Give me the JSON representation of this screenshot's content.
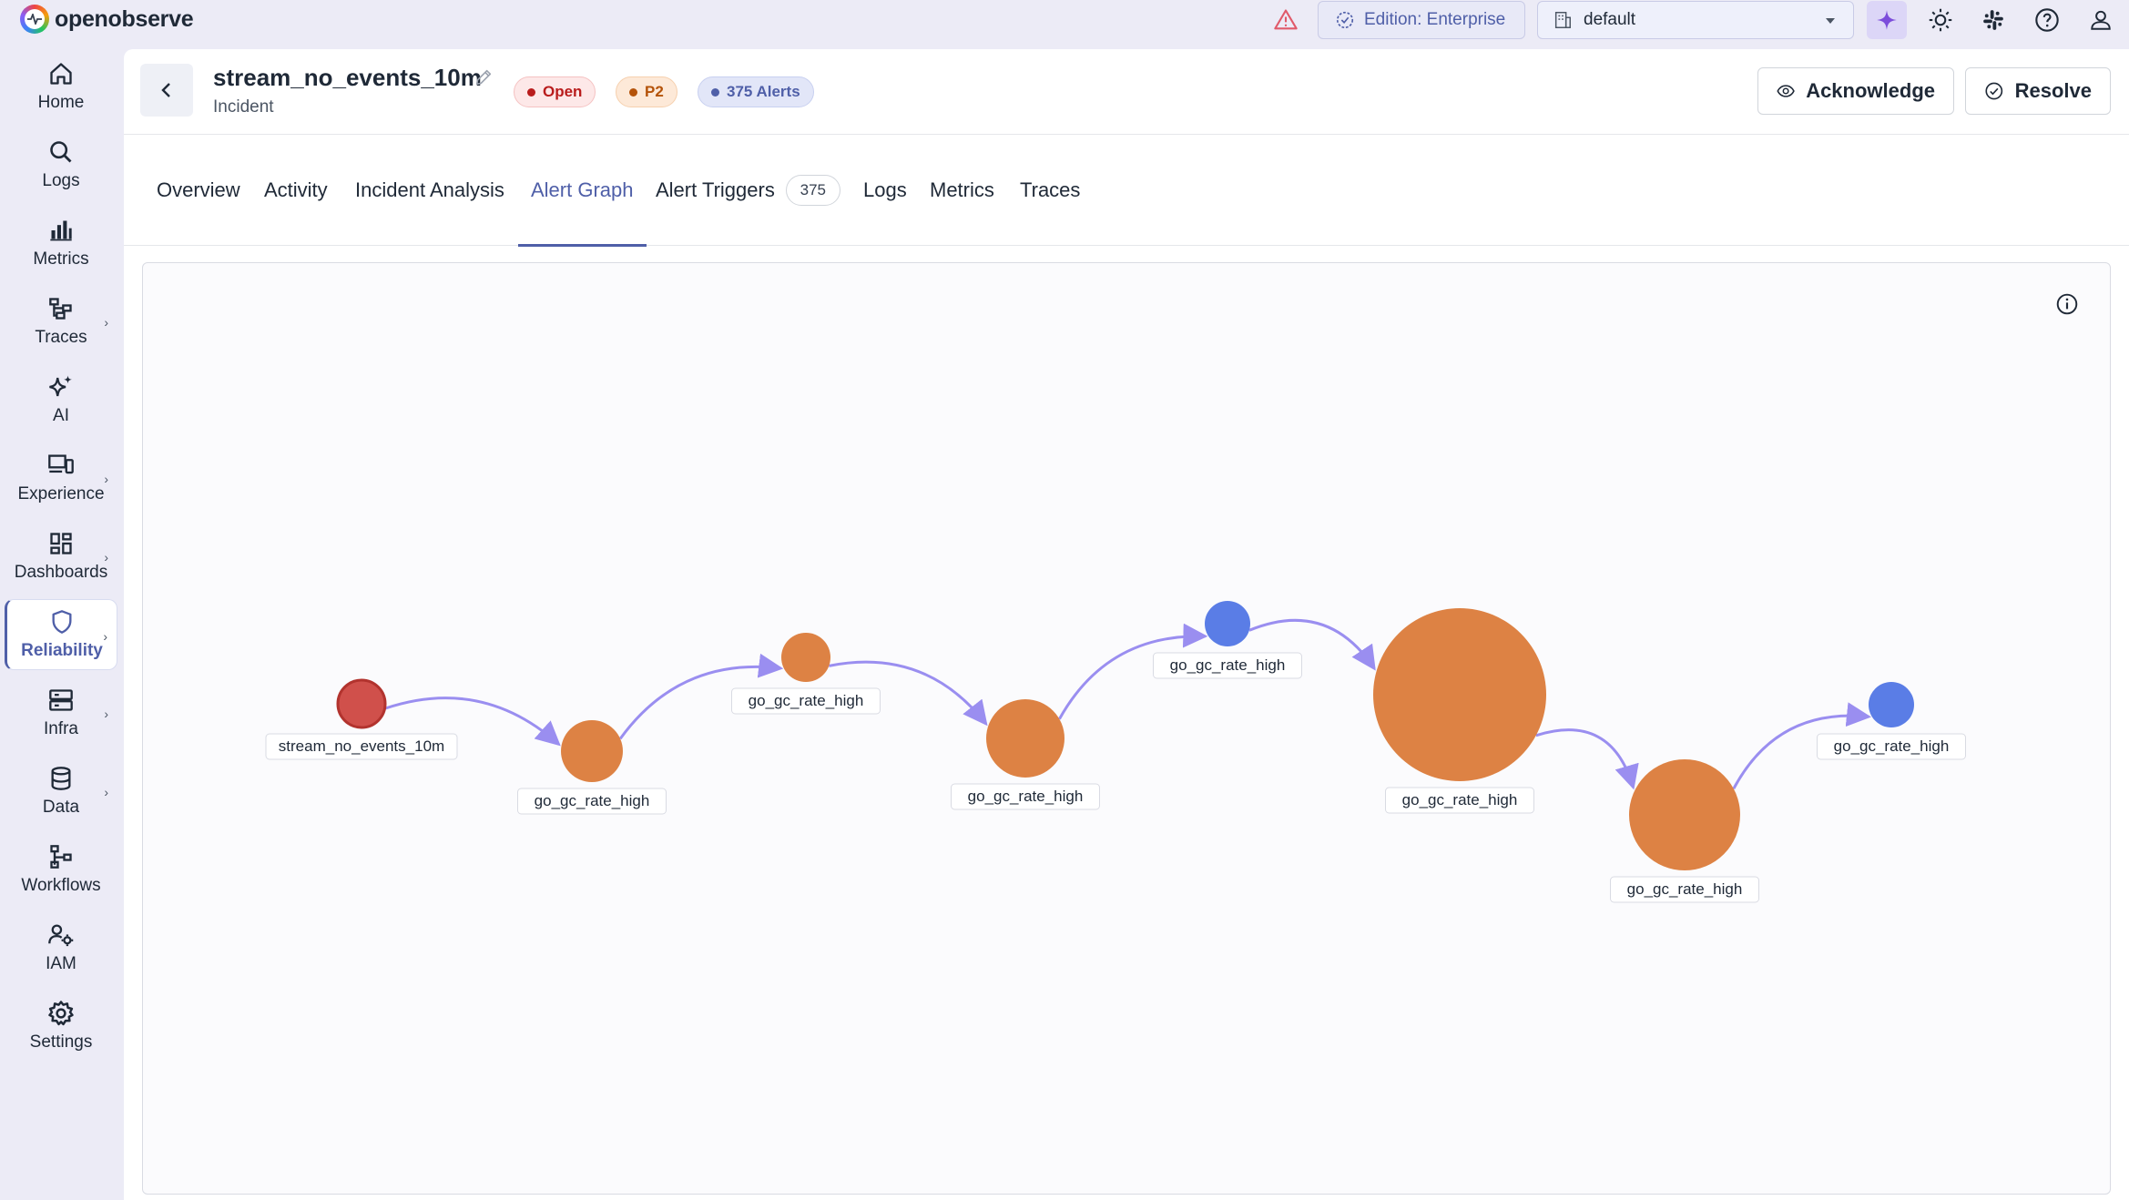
{
  "app": {
    "logo_text": "openobserve"
  },
  "topbar": {
    "edition_label": "Edition: Enterprise",
    "org_select_value": "default",
    "icons": [
      "warning-icon",
      "edition-icon",
      "building-icon",
      "ai-sparkle-icon",
      "sun-icon",
      "slack-icon",
      "help-icon",
      "user-icon"
    ]
  },
  "sidebar": {
    "items": [
      {
        "label": "Home",
        "icon": "home-icon",
        "has_submenu": false
      },
      {
        "label": "Logs",
        "icon": "search-icon",
        "has_submenu": false
      },
      {
        "label": "Metrics",
        "icon": "bar-chart-icon",
        "has_submenu": false
      },
      {
        "label": "Traces",
        "icon": "traces-icon",
        "has_submenu": true
      },
      {
        "label": "AI",
        "icon": "sparkle-icon",
        "has_submenu": false
      },
      {
        "label": "Experience",
        "icon": "devices-icon",
        "has_submenu": true
      },
      {
        "label": "Dashboards",
        "icon": "dashboard-icon",
        "has_submenu": true
      },
      {
        "label": "Reliability",
        "icon": "shield-icon",
        "has_submenu": true,
        "active": true
      },
      {
        "label": "Infra",
        "icon": "server-icon",
        "has_submenu": true
      },
      {
        "label": "Data",
        "icon": "database-icon",
        "has_submenu": true
      },
      {
        "label": "Workflows",
        "icon": "workflow-icon",
        "has_submenu": false
      },
      {
        "label": "IAM",
        "icon": "users-gear-icon",
        "has_submenu": false
      },
      {
        "label": "Settings",
        "icon": "gear-icon",
        "has_submenu": false
      }
    ]
  },
  "incident": {
    "title": "stream_no_events_10m",
    "subtitle": "Incident",
    "status_badge": "Open",
    "priority_badge": "P2",
    "alerts_badge": "375 Alerts",
    "acknowledge_label": "Acknowledge",
    "resolve_label": "Resolve"
  },
  "tabs": [
    {
      "label": "Overview"
    },
    {
      "label": "Activity"
    },
    {
      "label": "Incident Analysis"
    },
    {
      "label": "Alert Graph",
      "active": true
    },
    {
      "label": "Alert Triggers",
      "count": "375"
    },
    {
      "label": "Logs"
    },
    {
      "label": "Metrics"
    },
    {
      "label": "Traces"
    }
  ],
  "colors": {
    "accent": "#4f5fa8",
    "edge": "#9a8ef0",
    "node_root": "#d0504b",
    "node_orange": "#dd8244",
    "node_blue": "#5a7de6"
  },
  "graph": {
    "nodes": [
      {
        "label": "stream_no_events_10m",
        "kind": "root"
      },
      {
        "label": "go_gc_rate_high",
        "kind": "orange"
      },
      {
        "label": "go_gc_rate_high",
        "kind": "orange"
      },
      {
        "label": "go_gc_rate_high",
        "kind": "orange"
      },
      {
        "label": "go_gc_rate_high",
        "kind": "blue"
      },
      {
        "label": "go_gc_rate_high",
        "kind": "orange"
      },
      {
        "label": "go_gc_rate_high",
        "kind": "orange"
      },
      {
        "label": "go_gc_rate_high",
        "kind": "blue"
      }
    ],
    "edges": [
      [
        0,
        1
      ],
      [
        1,
        2
      ],
      [
        2,
        3
      ],
      [
        3,
        4
      ],
      [
        4,
        5
      ],
      [
        5,
        6
      ],
      [
        6,
        7
      ]
    ]
  }
}
